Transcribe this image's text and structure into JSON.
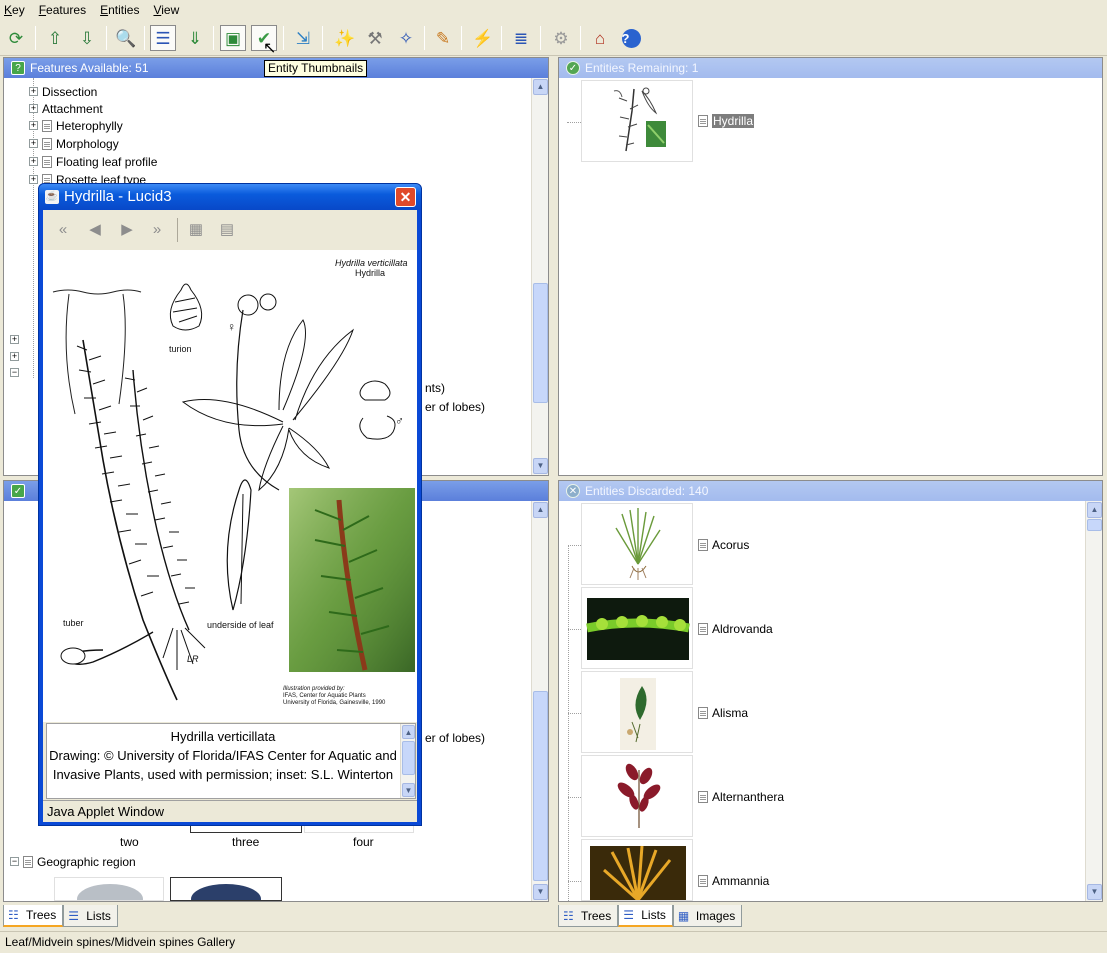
{
  "menu": [
    "Key",
    "Features",
    "Entities",
    "View"
  ],
  "tooltip": "Entity Thumbnails",
  "features_panel": {
    "title": "Features Available: 51",
    "tree": [
      {
        "label": "Dissection",
        "type": "folder"
      },
      {
        "label": "Attachment",
        "type": "folder"
      },
      {
        "label": "Heterophylly",
        "type": "doc"
      },
      {
        "label": "Morphology",
        "type": "doc"
      },
      {
        "label": "Floating leaf profile",
        "type": "doc"
      },
      {
        "label": "Rosette leaf type",
        "type": "doc"
      }
    ],
    "partial_right_1": "nts)",
    "partial_right_2": "er of lobes)"
  },
  "lower_left_panel": {
    "partial_right": "er of lobes)",
    "thumb_labels": [
      "two",
      "three",
      "four"
    ],
    "geo_region": "Geographic region"
  },
  "entities_remaining": {
    "title": "Entities Remaining: 1",
    "items": [
      "Hydrilla"
    ]
  },
  "entities_discarded": {
    "title": "Entities Discarded: 140",
    "items": [
      "Acorus",
      "Aldrovanda",
      "Alisma",
      "Alternanthera",
      "Ammannia"
    ]
  },
  "left_tabs": [
    "Trees",
    "Lists"
  ],
  "right_tabs": [
    "Trees",
    "Lists",
    "Images"
  ],
  "status_text": "Leaf/Midvein spines/Midvein spines Gallery",
  "popup": {
    "title": "Hydrilla - Lucid3",
    "plate_title": "Hydrilla verticillata",
    "plate_subtitle": "Hydrilla",
    "labels": {
      "turion": "turion",
      "tuber": "tuber",
      "underside": "underside of leaf",
      "initials": "LR",
      "female": "♀",
      "male": "♂"
    },
    "credit": [
      "Illustration provided by:",
      "IFAS, Center for Aquatic Plants",
      "University of Florida, Gainesville, 1990"
    ],
    "caption_title": "Hydrilla verticillata",
    "caption_body": "Drawing: © University of Florida/IFAS Center for Aquatic and Invasive Plants, used with permission; inset: S.L. Winterton",
    "applet_bar": "Java Applet Window"
  }
}
